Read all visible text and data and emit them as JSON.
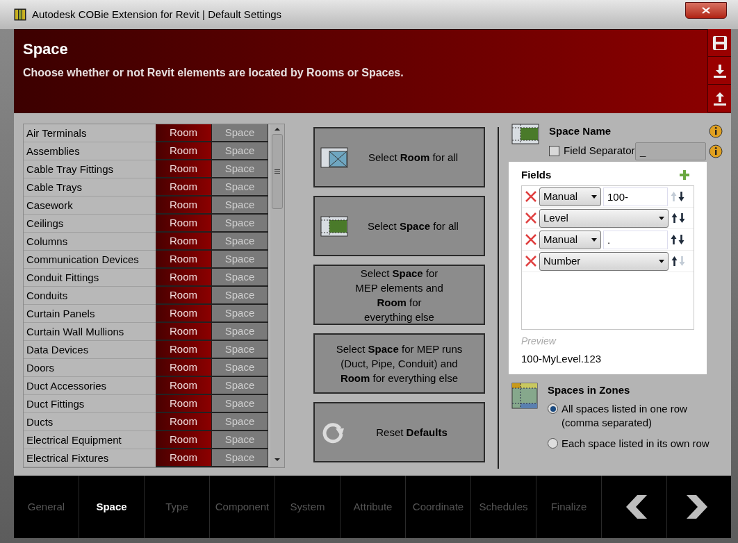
{
  "window": {
    "title": "Autodesk COBie Extension for Revit | Default Settings"
  },
  "header": {
    "title": "Space",
    "subtitle": "Choose whether or not Revit elements are located by Rooms or Spaces."
  },
  "categories": [
    {
      "name": "Air Terminals",
      "options": [
        {
          "label": "Room",
          "selected": true
        },
        {
          "label": "Space",
          "selected": false
        }
      ]
    },
    {
      "name": "Assemblies",
      "options": [
        {
          "label": "Room",
          "selected": true
        },
        {
          "label": "Space",
          "selected": false
        }
      ]
    },
    {
      "name": "Cable Tray Fittings",
      "options": [
        {
          "label": "Room",
          "selected": true
        },
        {
          "label": "Space",
          "selected": false
        }
      ]
    },
    {
      "name": "Cable Trays",
      "options": [
        {
          "label": "Room",
          "selected": true
        },
        {
          "label": "Space",
          "selected": false
        }
      ]
    },
    {
      "name": "Casework",
      "options": [
        {
          "label": "Room",
          "selected": true
        },
        {
          "label": "Space",
          "selected": false
        }
      ]
    },
    {
      "name": "Ceilings",
      "options": [
        {
          "label": "Room",
          "selected": true
        },
        {
          "label": "Space",
          "selected": false
        }
      ]
    },
    {
      "name": "Columns",
      "options": [
        {
          "label": "Room",
          "selected": true
        },
        {
          "label": "Space",
          "selected": false
        }
      ]
    },
    {
      "name": "Communication Devices",
      "options": [
        {
          "label": "Room",
          "selected": true
        },
        {
          "label": "Space",
          "selected": false
        }
      ]
    },
    {
      "name": "Conduit Fittings",
      "options": [
        {
          "label": "Room",
          "selected": true
        },
        {
          "label": "Space",
          "selected": false
        }
      ]
    },
    {
      "name": "Conduits",
      "options": [
        {
          "label": "Room",
          "selected": true
        },
        {
          "label": "Space",
          "selected": false
        }
      ]
    },
    {
      "name": "Curtain Panels",
      "options": [
        {
          "label": "Room",
          "selected": true
        },
        {
          "label": "Space",
          "selected": false
        }
      ]
    },
    {
      "name": "Curtain Wall Mullions",
      "options": [
        {
          "label": "Room",
          "selected": true
        },
        {
          "label": "Space",
          "selected": false
        }
      ]
    },
    {
      "name": "Data Devices",
      "options": [
        {
          "label": "Room",
          "selected": true
        },
        {
          "label": "Space",
          "selected": false
        }
      ]
    },
    {
      "name": "Doors",
      "options": [
        {
          "label": "Room",
          "selected": true
        },
        {
          "label": "Space",
          "selected": false
        }
      ]
    },
    {
      "name": "Duct Accessories",
      "options": [
        {
          "label": "Room",
          "selected": true
        },
        {
          "label": "Space",
          "selected": false
        }
      ]
    },
    {
      "name": "Duct Fittings",
      "options": [
        {
          "label": "Room",
          "selected": true
        },
        {
          "label": "Space",
          "selected": false
        }
      ]
    },
    {
      "name": "Ducts",
      "options": [
        {
          "label": "Room",
          "selected": true
        },
        {
          "label": "Space",
          "selected": false
        }
      ]
    },
    {
      "name": "Electrical Equipment",
      "options": [
        {
          "label": "Room",
          "selected": true
        },
        {
          "label": "Space",
          "selected": false
        }
      ]
    },
    {
      "name": "Electrical Fixtures",
      "options": [
        {
          "label": "Room",
          "selected": true
        },
        {
          "label": "Space",
          "selected": false
        }
      ]
    }
  ],
  "actions": [
    {
      "kind": "room",
      "label": "Select **Room** for all"
    },
    {
      "kind": "space",
      "label": "Select **Space** for all"
    },
    {
      "kind": "text",
      "lines": [
        "Select **Space** for",
        "MEP elements and",
        "**Room** for",
        "everything else"
      ]
    },
    {
      "kind": "text",
      "lines": [
        "Select **Space** for MEP runs",
        "(Duct, Pipe, Conduit) and",
        "**Room** for everything else"
      ]
    },
    {
      "kind": "reset",
      "label": "Reset **Defaults**"
    }
  ],
  "space_name": {
    "title": "Space Name",
    "field_separator": {
      "label": "Field Separator",
      "checked": false,
      "value": "_",
      "disabled": true
    },
    "fields_title": "Fields",
    "fields": [
      {
        "kind": "manual",
        "source": "Manual",
        "value": "100-",
        "up_enabled": false,
        "down_enabled": true
      },
      {
        "kind": "select",
        "source": "Level",
        "up_enabled": true,
        "down_enabled": true
      },
      {
        "kind": "manual",
        "source": "Manual",
        "value": ".",
        "up_enabled": true,
        "down_enabled": true
      },
      {
        "kind": "select",
        "source": "Number",
        "up_enabled": true,
        "down_enabled": false
      }
    ],
    "preview_label": "Preview",
    "preview": "100-MyLevel.123"
  },
  "spaces_in_zones": {
    "title": "Spaces in Zones",
    "options": [
      {
        "lines": [
          "All spaces listed in one row",
          "(comma separated)"
        ],
        "selected": true
      },
      {
        "lines": [
          "Each space listed in its own row"
        ],
        "selected": false
      }
    ]
  },
  "nav": [
    {
      "label": "General",
      "selected": false
    },
    {
      "label": "Space",
      "selected": true
    },
    {
      "label": "Type",
      "selected": false
    },
    {
      "label": "Component",
      "selected": false
    },
    {
      "label": "System",
      "selected": false
    },
    {
      "label": "Attribute",
      "selected": false
    },
    {
      "label": "Coordinate",
      "selected": false
    },
    {
      "label": "Schedules",
      "selected": false
    },
    {
      "label": "Finalize",
      "selected": false
    }
  ]
}
